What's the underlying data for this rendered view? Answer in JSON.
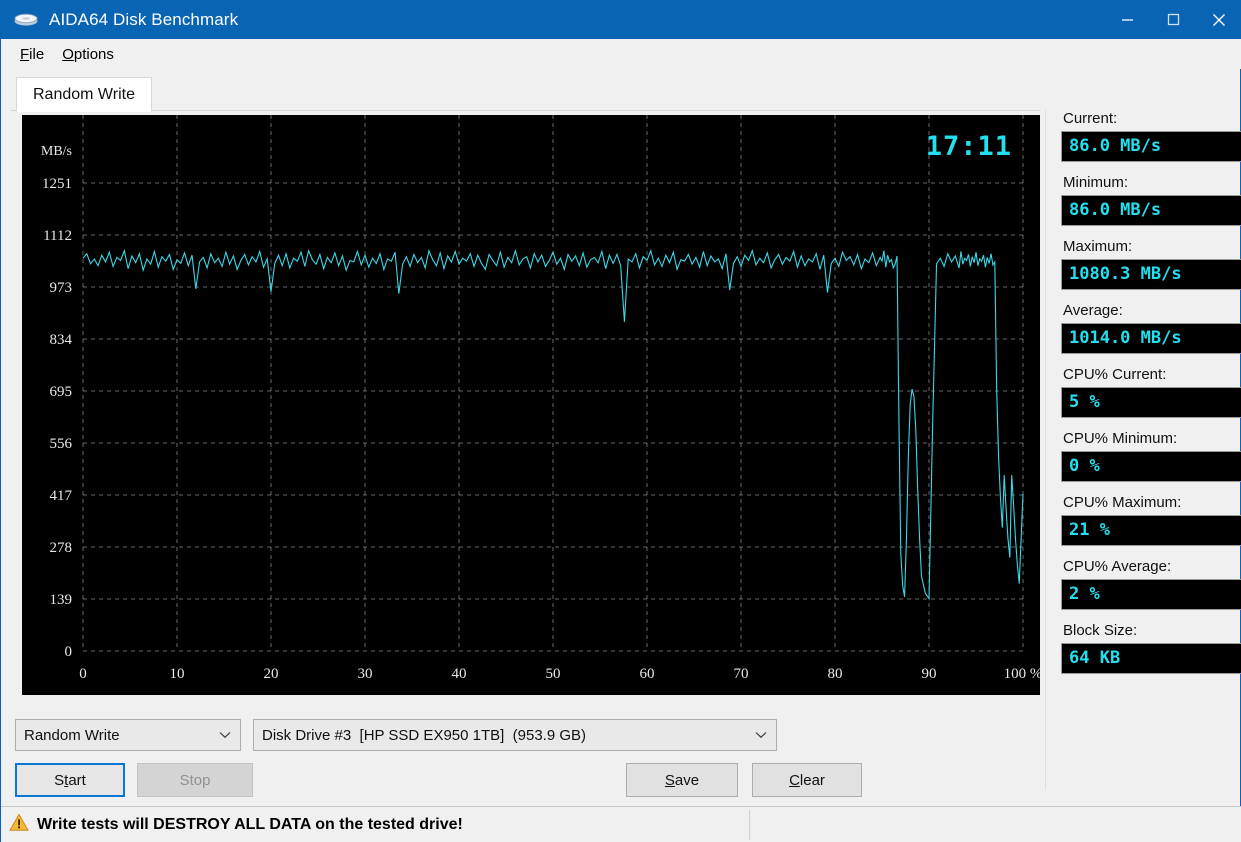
{
  "window": {
    "title": "AIDA64 Disk Benchmark",
    "icon": "disk-icon",
    "minimize": "—",
    "maximize": "□",
    "close": "✕",
    "titlebar_color": "#0a64b4"
  },
  "menu": {
    "items": [
      {
        "label": "File",
        "accel": "F"
      },
      {
        "label": "Options",
        "accel": "O"
      }
    ]
  },
  "tabs": [
    {
      "label": "Random Write",
      "active": true
    }
  ],
  "chart_data": {
    "type": "line",
    "title": "",
    "xlabel": "",
    "ylabel": "MB/s",
    "unit_label": "MB/s",
    "series_color": "#3ad8e8",
    "background": "#000000",
    "grid": true,
    "grid_color": "#8a8a8a",
    "legend": "none",
    "xlim": [
      0,
      100
    ],
    "ylim": [
      0,
      1390
    ],
    "xticks": [
      0,
      10,
      20,
      30,
      40,
      50,
      60,
      70,
      80,
      90,
      100
    ],
    "xticklabels": [
      "0",
      "10",
      "20",
      "30",
      "40",
      "50",
      "60",
      "70",
      "80",
      "90",
      "100 %"
    ],
    "yticks": [
      0,
      139,
      278,
      417,
      556,
      695,
      834,
      973,
      1112,
      1251
    ],
    "yticklabels": [
      "0",
      "139",
      "278",
      "417",
      "556",
      "695",
      "834",
      "973",
      "1112",
      "1251"
    ],
    "annotations": [
      {
        "text": "17:11",
        "role": "elapsed-time",
        "color": "#22e0ef"
      }
    ],
    "x": [
      0.0,
      0.4,
      0.8,
      1.2,
      1.6,
      2.0,
      2.4,
      2.8,
      3.2,
      3.6,
      4.0,
      4.4,
      4.8,
      5.2,
      5.6,
      6.0,
      6.4,
      6.8,
      7.2,
      7.6,
      8.0,
      8.4,
      8.8,
      9.2,
      9.6,
      10.0,
      10.4,
      10.8,
      11.2,
      11.6,
      12.0,
      12.4,
      12.8,
      13.2,
      13.6,
      14.0,
      14.4,
      14.8,
      15.2,
      15.6,
      16.0,
      16.4,
      16.8,
      17.2,
      17.6,
      18.0,
      18.4,
      18.8,
      19.2,
      19.6,
      20.0,
      20.4,
      20.8,
      21.2,
      21.6,
      22.0,
      22.4,
      22.8,
      23.2,
      23.6,
      24.0,
      24.4,
      24.8,
      25.2,
      25.6,
      26.0,
      26.4,
      26.8,
      27.2,
      27.6,
      28.0,
      28.4,
      28.8,
      29.2,
      29.6,
      30.0,
      30.4,
      30.8,
      31.2,
      31.6,
      32.0,
      32.4,
      32.8,
      33.2,
      33.6,
      34.0,
      34.4,
      34.8,
      35.2,
      35.6,
      36.0,
      36.4,
      36.8,
      37.2,
      37.6,
      38.0,
      38.4,
      38.8,
      39.2,
      39.6,
      40.0,
      40.4,
      40.8,
      41.2,
      41.6,
      42.0,
      42.4,
      42.8,
      43.2,
      43.6,
      44.0,
      44.4,
      44.8,
      45.2,
      45.6,
      46.0,
      46.4,
      46.8,
      47.2,
      47.6,
      48.0,
      48.4,
      48.8,
      49.2,
      49.6,
      50.0,
      50.4,
      50.8,
      51.2,
      51.6,
      52.0,
      52.4,
      52.8,
      53.2,
      53.6,
      54.0,
      54.4,
      54.8,
      55.2,
      55.6,
      56.0,
      56.4,
      56.8,
      57.2,
      57.6,
      58.0,
      58.4,
      58.8,
      59.2,
      59.6,
      60.0,
      60.4,
      60.8,
      61.2,
      61.6,
      62.0,
      62.4,
      62.8,
      63.2,
      63.6,
      64.0,
      64.4,
      64.8,
      65.2,
      65.6,
      66.0,
      66.4,
      66.8,
      67.2,
      67.6,
      68.0,
      68.4,
      68.8,
      69.2,
      69.6,
      70.0,
      70.4,
      70.8,
      71.2,
      71.6,
      72.0,
      72.4,
      72.8,
      73.2,
      73.6,
      74.0,
      74.4,
      74.8,
      75.2,
      75.6,
      76.0,
      76.4,
      76.8,
      77.2,
      77.6,
      78.0,
      78.4,
      78.8,
      79.2,
      79.6,
      80.0,
      80.4,
      80.8,
      81.2,
      81.6,
      82.0,
      82.4,
      82.8,
      83.2,
      83.6,
      84.0,
      84.4,
      84.8,
      85.0,
      85.2,
      85.4,
      85.6,
      85.8,
      86.0,
      86.2,
      86.4,
      86.6,
      86.8,
      87.0,
      87.2,
      87.4,
      87.6,
      87.8,
      88.0,
      88.2,
      88.4,
      88.6,
      88.8,
      89.0,
      89.2,
      89.6,
      90.0,
      90.4,
      90.8,
      91.2,
      91.6,
      92.0,
      92.4,
      92.8,
      93.2,
      93.4,
      93.6,
      93.8,
      94.0,
      94.2,
      94.4,
      94.6,
      94.8,
      95.0,
      95.2,
      95.4,
      95.6,
      95.8,
      96.0,
      96.2,
      96.4,
      96.6,
      96.8,
      97.0,
      97.2,
      97.4,
      97.6,
      97.8,
      98.0,
      98.2,
      98.4,
      98.6,
      98.8,
      99.0,
      99.2,
      99.4,
      99.6,
      99.8,
      100.0
    ],
    "values": [
      1050,
      1062,
      1035,
      1048,
      1030,
      1058,
      1040,
      1066,
      1028,
      1052,
      1044,
      1070,
      1022,
      1056,
      1038,
      1062,
      1018,
      1048,
      1034,
      1068,
      1026,
      1054,
      1042,
      1060,
      1020,
      1046,
      1036,
      1064,
      1030,
      1058,
      968,
      1040,
      1052,
      1024,
      1062,
      1038,
      1050,
      1028,
      1066,
      1034,
      1056,
      1020,
      1044,
      1060,
      1032,
      1054,
      1040,
      1068,
      1026,
      1048,
      960,
      1036,
      1058,
      1030,
      1062,
      1024,
      1050,
      1042,
      1066,
      1028,
      1070,
      1046,
      1034,
      1060,
      1022,
      1052,
      1038,
      1064,
      1030,
      1056,
      1018,
      1044,
      1040,
      1068,
      1032,
      1058,
      1026,
      1050,
      1036,
      1062,
      1020,
      1048,
      1042,
      1066,
      955,
      1034,
      1054,
      1028,
      1060,
      1038,
      1052,
      1024,
      1070,
      1046,
      1030,
      1064,
      1022,
      1056,
      1040,
      1068,
      1034,
      1050,
      1042,
      1062,
      1028,
      1058,
      1036,
      1020,
      1060,
      1044,
      1030,
      1066,
      1026,
      1052,
      1038,
      1070,
      1032,
      1048,
      1054,
      1024,
      1062,
      1040,
      1058,
      1028,
      1044,
      1066,
      1034,
      1050,
      1020,
      1060,
      1042,
      1056,
      1030,
      1064,
      1026,
      1046,
      1052,
      1038,
      1068,
      1022,
      1058,
      1036,
      1060,
      1030,
      880,
      1048,
      1040,
      1062,
      1024,
      1054,
      1044,
      1070,
      1032,
      1050,
      1028,
      1058,
      1038,
      1066,
      1020,
      1046,
      1042,
      1060,
      1034,
      1052,
      1026,
      1068,
      1030,
      1056,
      1040,
      1048,
      1022,
      1062,
      965,
      1036,
      1054,
      1028,
      1058,
      1044,
      1070,
      1032,
      1050,
      1038,
      1064,
      1024,
      1046,
      1060,
      1034,
      1052,
      1042,
      1068,
      1026,
      1056,
      1030,
      1048,
      1040,
      1062,
      1020,
      1058,
      958,
      1036,
      1050,
      1028,
      1066,
      1044,
      1054,
      1032,
      1060,
      1022,
      1048,
      1038,
      1064,
      1030,
      1052,
      1042,
      1070,
      1026,
      1058,
      1040,
      1046,
      1024,
      1034,
      1056,
      620,
      260,
      175,
      145,
      300,
      520,
      660,
      700,
      680,
      590,
      430,
      300,
      200,
      155,
      140,
      620,
      1035,
      1050,
      1028,
      1062,
      1040,
      1056,
      1024,
      1068,
      1034,
      1050,
      1044,
      1060,
      1028,
      1054,
      1038,
      1066,
      1030,
      1048,
      1042,
      1058,
      1026,
      1052,
      1036,
      1062,
      1032,
      1040,
      700,
      520,
      410,
      330,
      470,
      380,
      300,
      250,
      470,
      390,
      300,
      230,
      180,
      300,
      420,
      250,
      160,
      120,
      230,
      350,
      170,
      105,
      90,
      140,
      260,
      180,
      100,
      85,
      120,
      200,
      150,
      95,
      86
    ],
    "summary_points": {
      "plateau_mean": 1045,
      "deep_dip_1_pct": 86.0,
      "deep_dip_1_value": 145,
      "drop_start_pct": 93.2,
      "final_value": 86
    }
  },
  "controls": {
    "test_combo": {
      "value": "Random Write",
      "arrow": "chevron-down-icon"
    },
    "drive_combo": {
      "value": "Disk Drive #3  [HP SSD EX950 1TB]  (953.9 GB)",
      "arrow": "chevron-down-icon"
    },
    "buttons": {
      "start": {
        "label": "Start",
        "accel": "t",
        "focused": true,
        "disabled": false
      },
      "stop": {
        "label": "Stop",
        "disabled": true
      },
      "save": {
        "label": "Save",
        "accel": "S",
        "disabled": false
      },
      "clear": {
        "label": "Clear",
        "accel": "C",
        "disabled": false
      }
    }
  },
  "stats": [
    {
      "label": "Current:",
      "value": "86.0 MB/s"
    },
    {
      "label": "Minimum:",
      "value": "86.0 MB/s"
    },
    {
      "label": "Maximum:",
      "value": "1080.3 MB/s"
    },
    {
      "label": "Average:",
      "value": "1014.0 MB/s"
    },
    {
      "label": "CPU% Current:",
      "value": "5 %"
    },
    {
      "label": "CPU% Minimum:",
      "value": "0 %"
    },
    {
      "label": "CPU% Maximum:",
      "value": "21 %"
    },
    {
      "label": "CPU% Average:",
      "value": "2 %"
    },
    {
      "label": "Block Size:",
      "value": "64 KB"
    }
  ],
  "statusbar": {
    "icon": "warning-triangle-icon",
    "text": "Write tests will DESTROY ALL DATA on the tested drive!"
  },
  "colors": {
    "accent": "#0a64b4",
    "chart_line": "#3ad8e8",
    "value_text": "#22e0ef",
    "warning": "#f5b93b"
  }
}
